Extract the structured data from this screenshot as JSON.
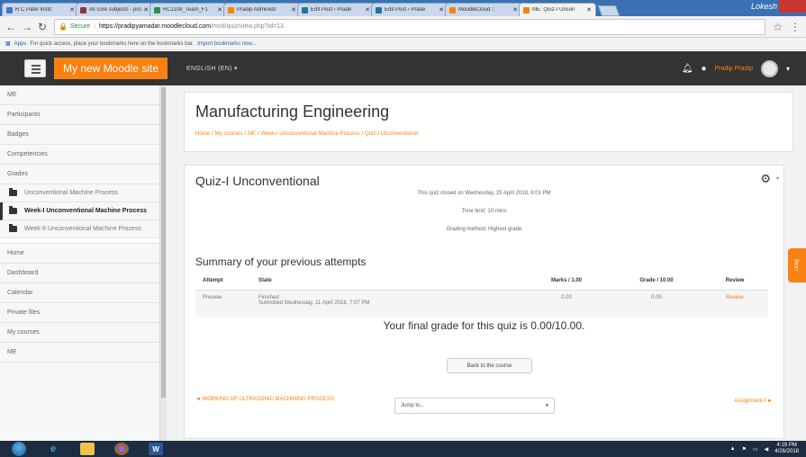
{
  "browser": {
    "tabs": [
      {
        "title": "R C Patel Instit",
        "fav": "#3b78c4"
      },
      {
        "title": "All core subjects - pro",
        "fav": "#8b3a3a"
      },
      {
        "title": "RC1108_Team_F1",
        "fav": "#2a8f4c"
      },
      {
        "title": "Pradip Administr",
        "fav": "#f98012"
      },
      {
        "title": "Edit Post ‹ Prade",
        "fav": "#21759b"
      },
      {
        "title": "Edit Post ‹ Prade",
        "fav": "#21759b"
      },
      {
        "title": "MoodleCloud ::",
        "fav": "#f98012"
      },
      {
        "title": "ME: Quiz-I Uncon",
        "fav": "#f98012"
      }
    ],
    "profile_label": "Lokesh",
    "url_secure_label": "Secure",
    "url_host": "https://pradipyamadar.moodlecloud.com",
    "url_path": "/mod/quiz/view.php?id=13",
    "bookmarks_apps": "Apps",
    "bookmarks_text": "For quick access, place your bookmarks here on the bookmarks bar.",
    "bookmarks_import": "Import bookmarks now..."
  },
  "navbar": {
    "site_name": "My new Moodle site",
    "language": "ENGLISH (EN) ▾",
    "user_name": "Pradip Pradip"
  },
  "sidebar": {
    "items_top": [
      "ME",
      "Participants",
      "Badges",
      "Competencies",
      "Grades"
    ],
    "sections": [
      {
        "label": "Unconventional Machine Process",
        "active": false
      },
      {
        "label": "Week-I Unconventional Machine Process",
        "active": true
      },
      {
        "label": "Week-II Unconventional Machine Process",
        "active": false
      }
    ],
    "items_bottom": [
      "Home",
      "Dashboard",
      "Calendar",
      "Private files",
      "My courses",
      "ME"
    ]
  },
  "header": {
    "course_title": "Manufacturing Engineering",
    "breadcrumb": [
      "Home",
      "My courses",
      "ME",
      "Week-I Unconventional Machine Process"
    ],
    "breadcrumb_current": "Quiz-I Unconventional"
  },
  "quiz": {
    "title": "Quiz-I Unconventional",
    "closed_text": "This quiz closed on Wednesday, 25 April 2018, 6:01 PM",
    "time_limit": "Time limit: 10 mins",
    "grading_method": "Grading method: Highest grade",
    "summary_heading": "Summary of your previous attempts",
    "columns": [
      "Attempt",
      "State",
      "Marks / 1.00",
      "Grade / 10.00",
      "Review"
    ],
    "rows": [
      {
        "attempt": "Preview",
        "state": "Finished",
        "submitted": "Submitted Wednesday, 11 April 2018, 7:07 PM",
        "marks": "0.00",
        "grade": "0.00",
        "review": "Review"
      }
    ],
    "final_grade": "Your final grade for this quiz is 0.00/10.00.",
    "back_button": "Back to the course",
    "prev_link": "◄ WORKING OF ULTRASONIC MACHINING PROCESS",
    "jump_placeholder": "Jump to...",
    "next_link": "Assignment-I ►"
  },
  "block_tab_label": "Drag",
  "taskbar": {
    "time": "4:19 PM",
    "date": "4/26/2018"
  }
}
